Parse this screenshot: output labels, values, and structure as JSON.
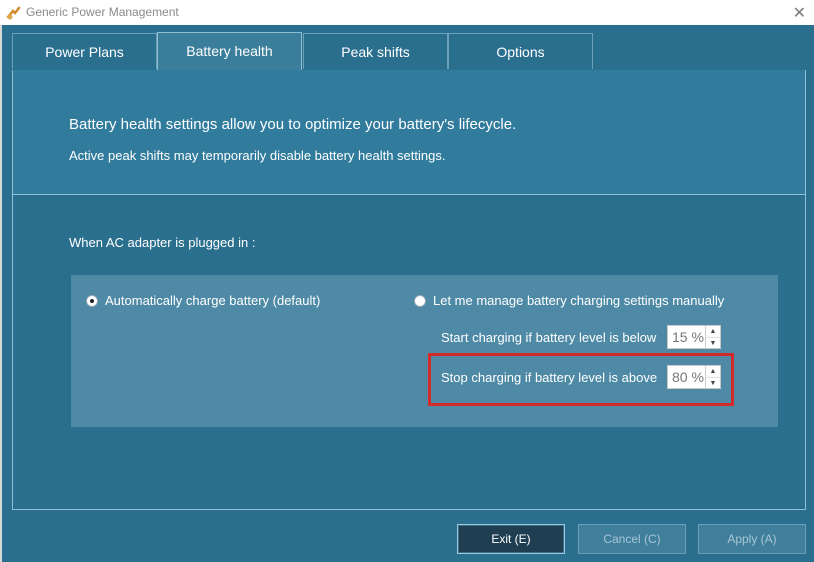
{
  "window": {
    "title": "Generic Power Management"
  },
  "tabs": [
    {
      "label": "Power Plans"
    },
    {
      "label": "Battery health",
      "active": true
    },
    {
      "label": "Peak shifts"
    },
    {
      "label": "Options"
    }
  ],
  "intro": {
    "main": "Battery health settings allow you to optimize your battery's lifecycle.",
    "sub": "Active peak shifts may temporarily disable battery health settings."
  },
  "ac_section": {
    "label": "When AC adapter is plugged in :",
    "option_auto": {
      "label": "Automatically charge battery (default)",
      "selected": true
    },
    "option_manual": {
      "label": "Let me manage battery charging settings manually",
      "selected": false
    },
    "start_charging": {
      "label": "Start charging if battery level is below",
      "value": "15 %"
    },
    "stop_charging": {
      "label": "Stop charging if battery level is above",
      "value": "80 %"
    }
  },
  "buttons": {
    "exit": "Exit (E)",
    "cancel": "Cancel (C)",
    "apply": "Apply (A)"
  },
  "colors": {
    "window_bg": "#2b6f8e",
    "highlight": "#d42a2a"
  },
  "icons": {
    "app": "battery-plug-icon",
    "close": "close-icon",
    "spinner_up": "chevron-up-icon",
    "spinner_down": "chevron-down-icon"
  }
}
